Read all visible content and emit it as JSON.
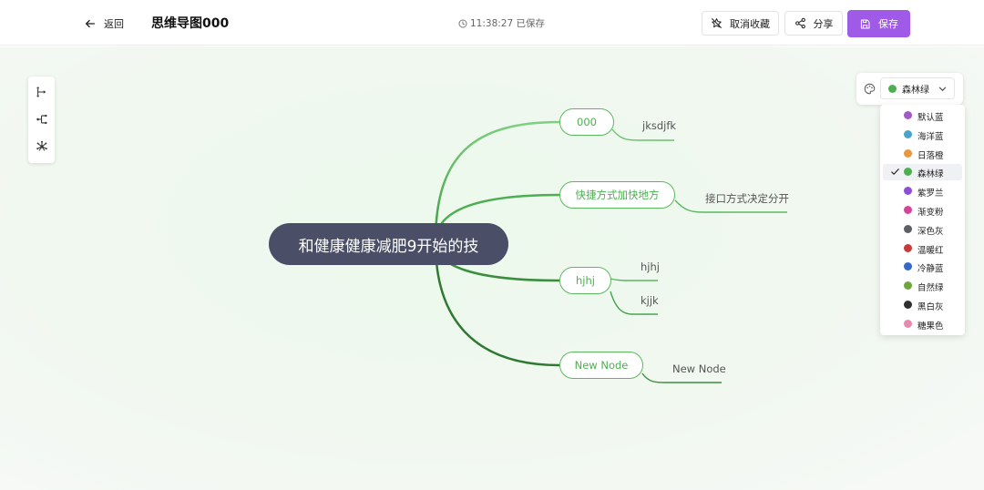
{
  "header": {
    "back_label": "返回",
    "title": "思维导图000",
    "saved_status": "11:38:27 已保存",
    "unfavorite_label": "取消收藏",
    "share_label": "分享",
    "save_label": "保存"
  },
  "toolbar": {
    "tools": [
      {
        "icon": "layout-right-icon"
      },
      {
        "icon": "layout-left-icon"
      },
      {
        "icon": "layout-radial-icon"
      }
    ]
  },
  "mindmap": {
    "root": "和健康健康减肥9开始的技",
    "branches": [
      {
        "label": "000",
        "children": [
          "jksdjfk"
        ]
      },
      {
        "label": "快捷方式加快地方",
        "children": [
          "接口方式决定分开"
        ]
      },
      {
        "label": "hjhj",
        "children": [
          "hjhj",
          "kjjk"
        ]
      },
      {
        "label": "New Node",
        "children": [
          "New Node"
        ]
      }
    ]
  },
  "theme": {
    "selected": {
      "label": "森林绿",
      "color": "#4caf50"
    },
    "options": [
      {
        "label": "默认蓝",
        "color": "#a25bc6",
        "selected": false
      },
      {
        "label": "海洋蓝",
        "color": "#4aa3c8",
        "selected": false
      },
      {
        "label": "日落橙",
        "color": "#e8973a",
        "selected": false
      },
      {
        "label": "森林绿",
        "color": "#4caf50",
        "selected": true
      },
      {
        "label": "紫罗兰",
        "color": "#8e4fd8",
        "selected": false
      },
      {
        "label": "渐变粉",
        "color": "#d6449a",
        "selected": false
      },
      {
        "label": "深色灰",
        "color": "#5c5f66",
        "selected": false
      },
      {
        "label": "温暖红",
        "color": "#c93b3b",
        "selected": false
      },
      {
        "label": "冷静蓝",
        "color": "#3468c9",
        "selected": false
      },
      {
        "label": "自然绿",
        "color": "#6fa63a",
        "selected": false
      },
      {
        "label": "黑白灰",
        "color": "#2f2f2f",
        "selected": false
      },
      {
        "label": "糖果色",
        "color": "#e68ab0",
        "selected": false
      }
    ]
  }
}
